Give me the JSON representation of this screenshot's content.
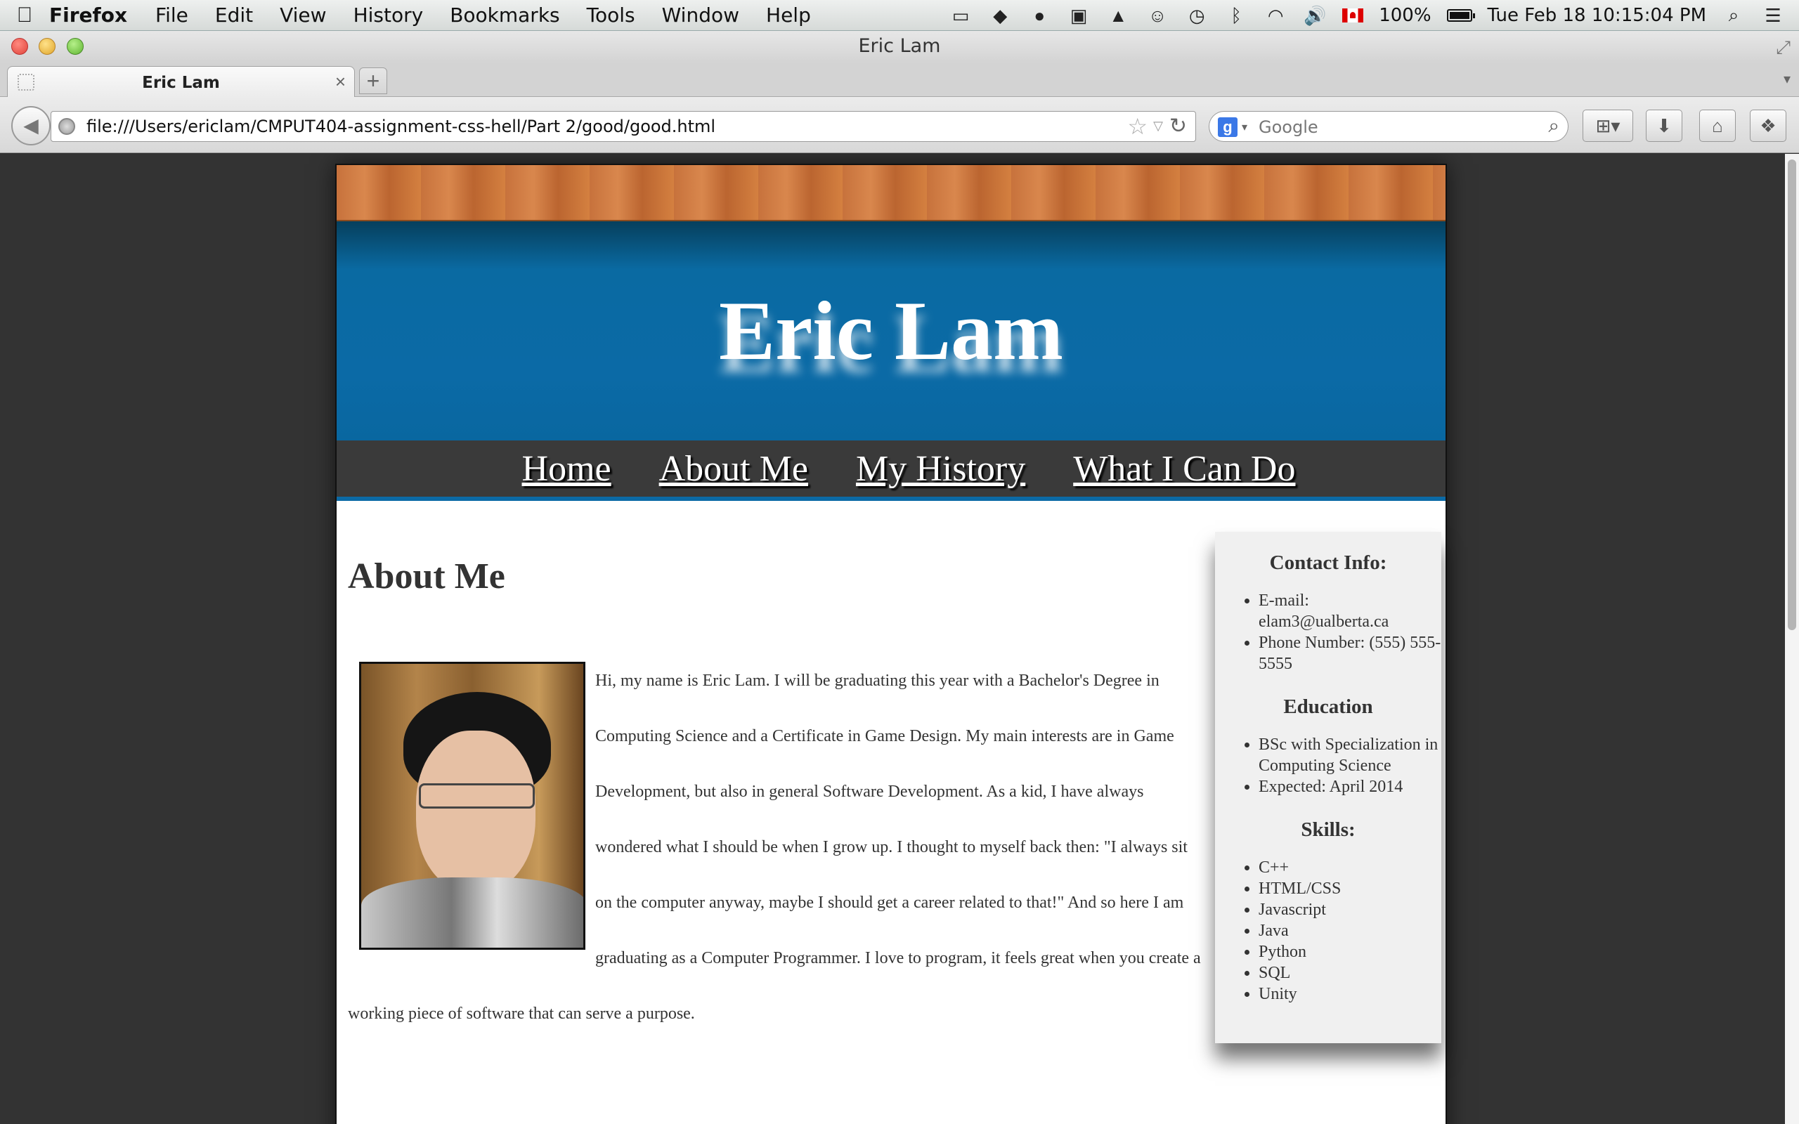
{
  "menubar": {
    "app": "Firefox",
    "items": [
      "File",
      "Edit",
      "View",
      "History",
      "Bookmarks",
      "Tools",
      "Window",
      "Help"
    ],
    "battery": "100%",
    "datetime": "Tue Feb 18  10:15:04 PM"
  },
  "window": {
    "title": "Eric Lam"
  },
  "tab": {
    "title": "Eric Lam",
    "close": "×",
    "new": "+"
  },
  "navbar": {
    "url": "file:///Users/ericlam/CMPUT404-assignment-css-hell/Part 2/good/good.html",
    "search_placeholder": "Google"
  },
  "site": {
    "title": "Eric Lam",
    "nav": [
      "Home",
      "About Me",
      "My History",
      "What I Can Do"
    ],
    "heading": "About Me",
    "bio": "Hi, my name is Eric Lam. I will be graduating this year with a Bachelor's Degree in Computing Science and a Certificate in Game Design. My main interests are in Game Development, but also in general Software Development. As a kid, I have always wondered what I should be when I grow up. I thought to myself back then: \"I always sit on the computer anyway, maybe I should get a career related to that!\" And so here I am graduating as a Computer Programmer. I love to program, it feels great when you create a working piece of software that can serve a purpose."
  },
  "sidebar": {
    "contact_heading": "Contact Info:",
    "contact": [
      "E-mail: elam3@ualberta.ca",
      "Phone Number: (555) 555-5555"
    ],
    "education_heading": "Education",
    "education": [
      "BSc with Specialization in Computing Science",
      "Expected: April 2014"
    ],
    "skills_heading": "Skills:",
    "skills": [
      "C++",
      "HTML/CSS",
      "Javascript",
      "Java",
      "Python",
      "SQL",
      "Unity"
    ]
  },
  "colors": {
    "header_blue": "#0b6aa6",
    "nav_bg": "#3a3a3a",
    "sidebar_bg": "#f0f0f0"
  },
  "icons": [
    "apple-icon",
    "back-arrow-icon",
    "globe-icon",
    "star-icon",
    "reload-icon",
    "google-icon",
    "search-icon",
    "download-icon",
    "home-icon"
  ]
}
